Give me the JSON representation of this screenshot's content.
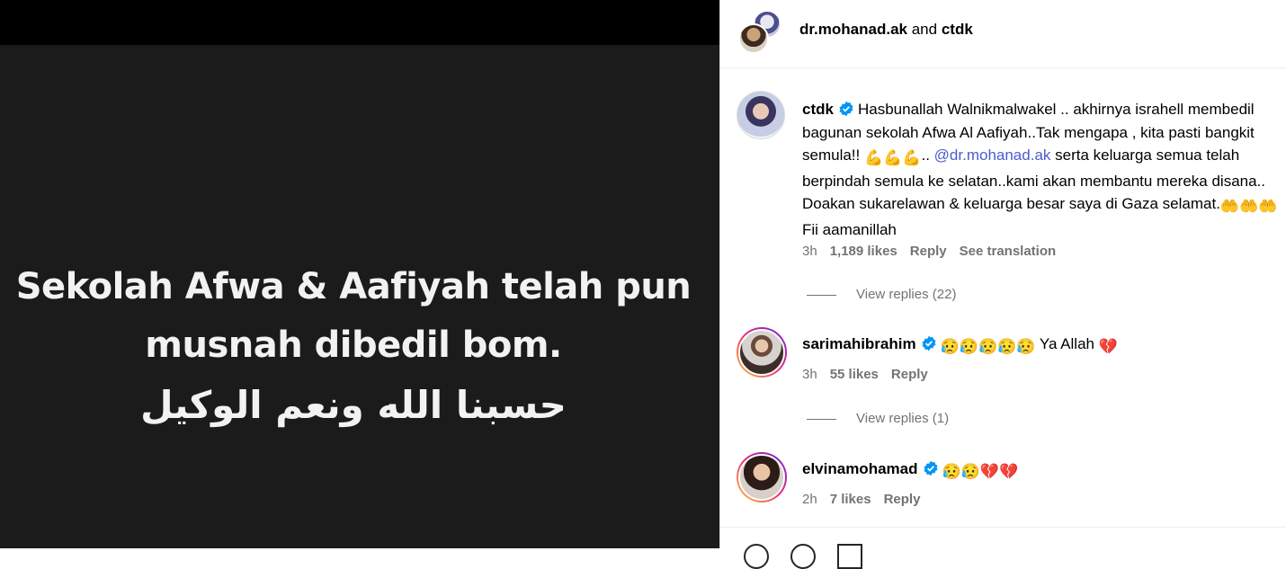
{
  "post": {
    "text_lines": [
      "Sekolah Afwa & Aafiyah telah pun",
      "musnah dibedil bom.",
      "حسبنا الله ونعم الوكيل"
    ]
  },
  "header": {
    "user1": "dr.mohanad.ak",
    "joiner": "and",
    "user2": "ctdk"
  },
  "comments": [
    {
      "username": "ctdk",
      "text_part1": "Hasbunallah Walnikmalwakel .. akhirnya israhell membedil bagunan sekolah Afwa Al Aafiyah..Tak mengapa , kita pasti bangkit semula!! ",
      "emojis1": "💪💪💪",
      "text_part2": ".. ",
      "mention": "@dr.mohanad.ak",
      "text_part3": " serta keluarga semua telah berpindah semula ke selatan..kami akan membantu mereka disana.. Doakan sukarelawan & keluarga besar saya di Gaza selamat.",
      "emojis2": "🤲🤲🤲",
      "text_part4": " Fii aamanillah",
      "time": "3h",
      "likes": "1,189 likes",
      "reply": "Reply",
      "translation": "See translation",
      "view_replies": "View replies (22)"
    },
    {
      "username": "sarimahibrahim",
      "emojis": "😥😥😥😥😥",
      "text": " Ya Allah ",
      "heart": "💔",
      "time": "3h",
      "likes": "55 likes",
      "reply": "Reply",
      "view_replies": "View replies (1)"
    },
    {
      "username": "elvinamohamad",
      "emojis": "😥😥",
      "heart": "💔💔",
      "time": "2h",
      "likes": "7 likes",
      "reply": "Reply"
    }
  ],
  "colors": {
    "verified": "#0095f6",
    "mention": "#4a5ccf",
    "muted": "#737373"
  }
}
